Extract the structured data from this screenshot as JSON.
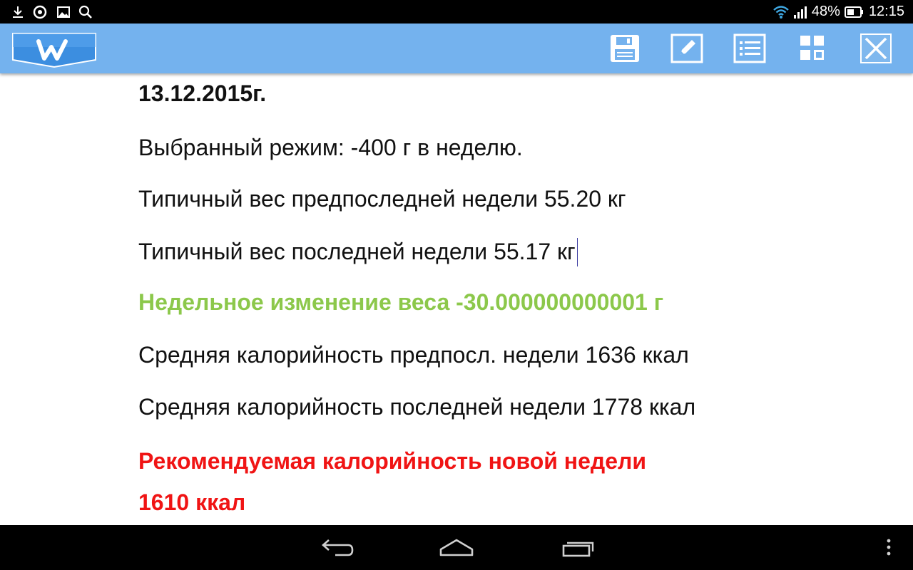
{
  "status_bar": {
    "battery": "48%",
    "time": "12:15",
    "left_icons": [
      "download-icon",
      "record-icon",
      "image-icon",
      "search-icon"
    ],
    "right_icons": [
      "wifi-icon",
      "signal-icon",
      "battery-icon"
    ]
  },
  "toolbar": {
    "logo_icon": "w-logo-icon",
    "buttons": [
      "save-icon",
      "edit-icon",
      "list-icon",
      "grid-icon",
      "close-icon"
    ],
    "background": "#74b2ee"
  },
  "document": {
    "date": "13.12.2015г.",
    "mode": "Выбранный режим: -400 г в неделю.",
    "prev_week_weight": "Типичный вес предпоследней недели 55.20 кг",
    "last_week_weight": "Типичный вес последней недели 55.17 кг",
    "weekly_change": "Недельное изменение веса -30.000000000001 г",
    "prev_week_calories": "Средняя калорийность предпосл. недели 1636 ккал",
    "last_week_calories": "Средняя калорийность последней недели 1778 ккал",
    "recommended_line1": "Рекомендуемая калорийность новой недели",
    "recommended_line2": "1610 ккал",
    "colors": {
      "text": "#111111",
      "change": "#8cc84b",
      "recommended": "#f01414"
    }
  },
  "nav_bar": {
    "buttons": [
      "back-icon",
      "home-icon",
      "recent-apps-icon",
      "menu-icon"
    ]
  }
}
